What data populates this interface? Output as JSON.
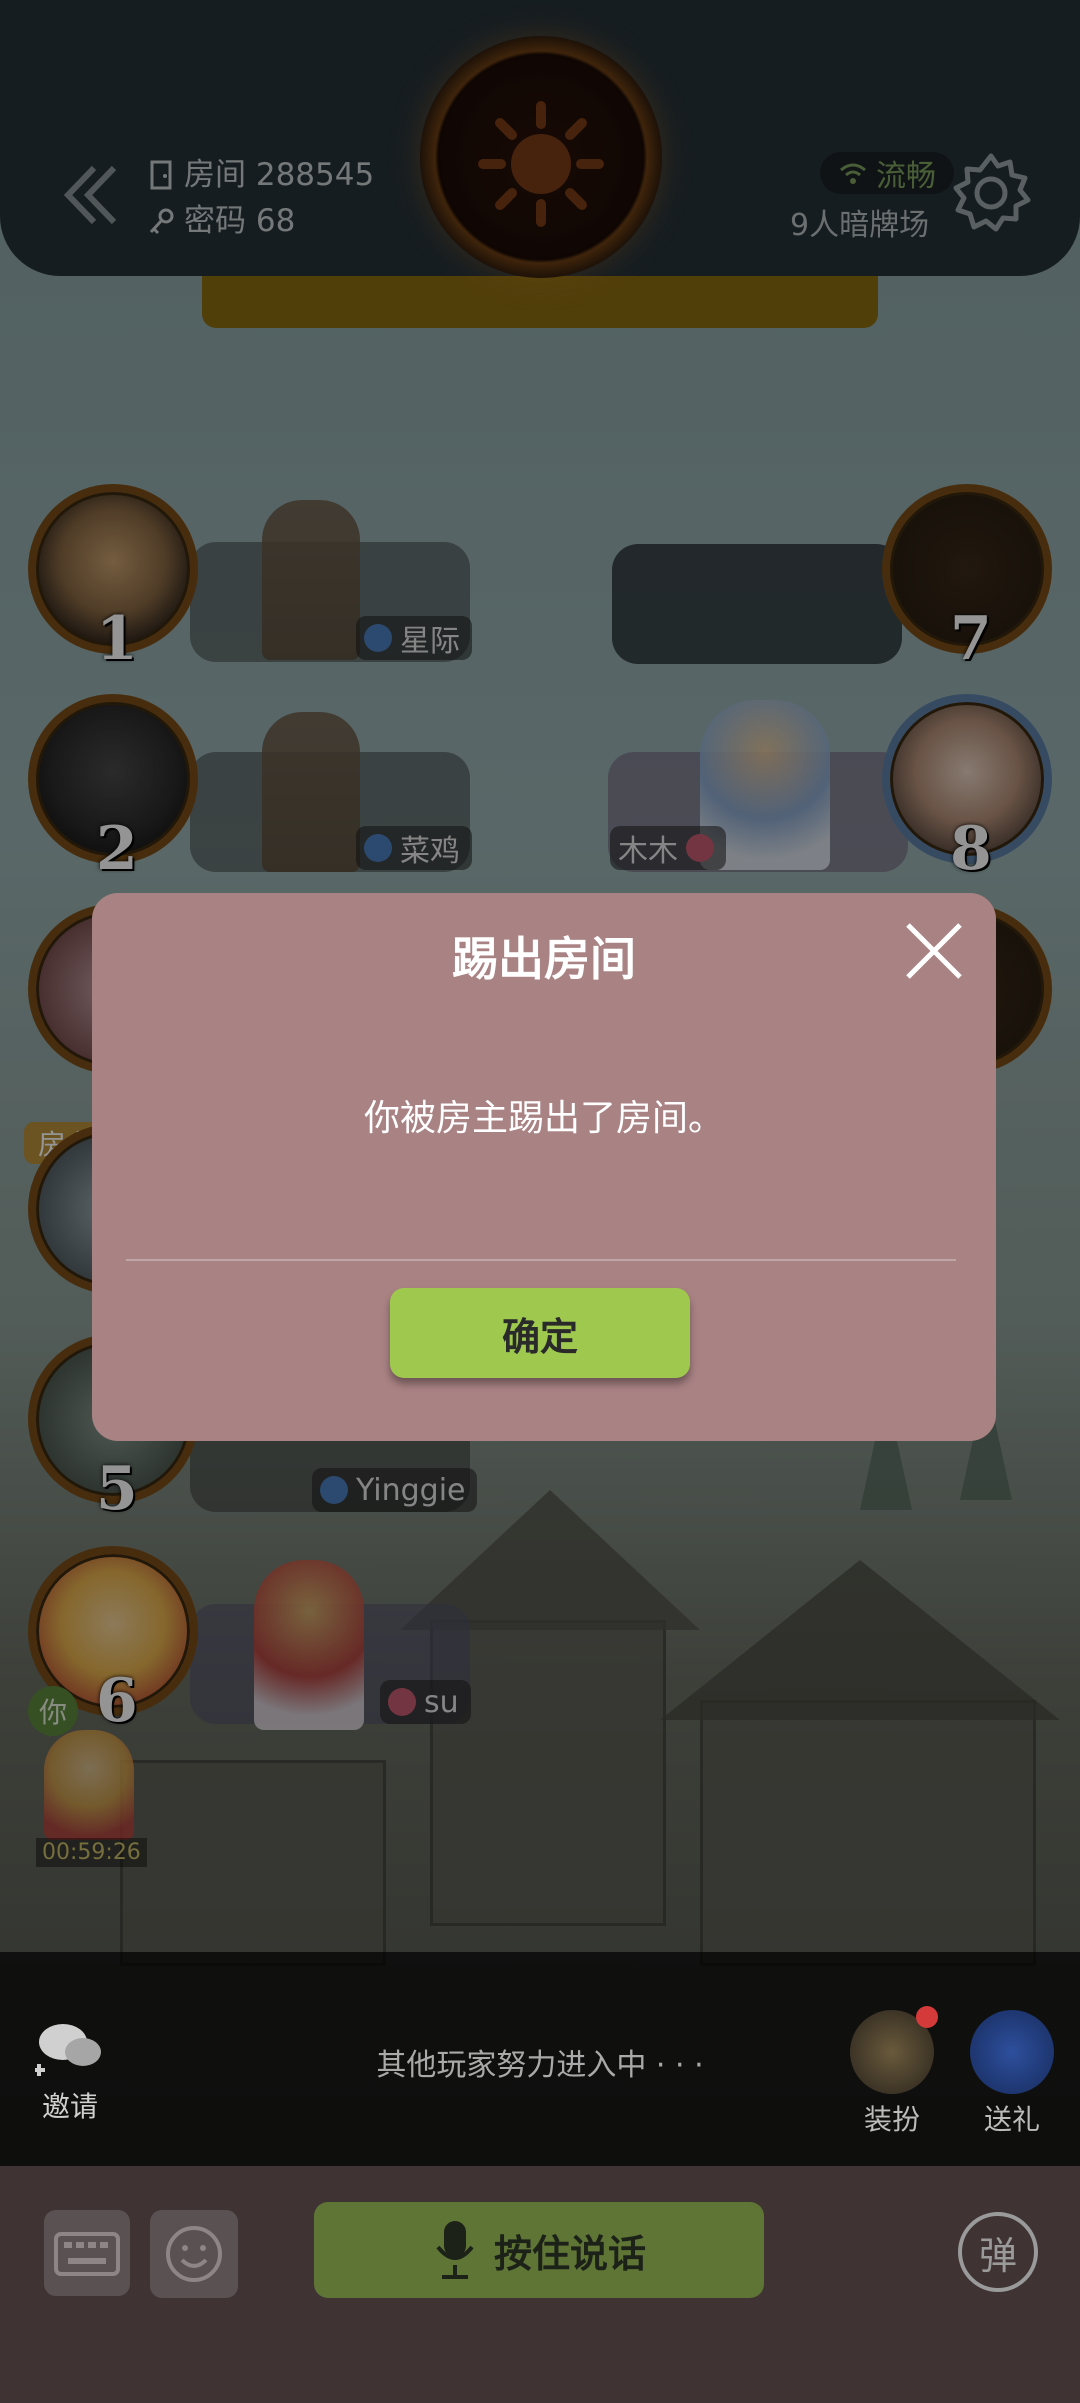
{
  "header": {
    "room_label": "房间 288545",
    "password_label": "密码 68",
    "network_status": "流畅",
    "game_mode": "9人暗牌场"
  },
  "seats": {
    "left": [
      {
        "number": "1",
        "name": "星际",
        "gender": "male"
      },
      {
        "number": "2",
        "name": "菜鸡",
        "gender": "male"
      },
      {
        "number": "5",
        "name": "Yinggie",
        "gender": "male"
      },
      {
        "number": "6",
        "name": "su",
        "gender": "female"
      }
    ],
    "right": [
      {
        "number": "7",
        "name": ""
      },
      {
        "number": "8",
        "name": "木木",
        "gender": "female"
      }
    ],
    "host_tag": "房主",
    "you_badge": "你",
    "timer": "00:59:26"
  },
  "bottom": {
    "invite_label": "邀请",
    "waiting_text": "其他玩家努力进入中 · · ·",
    "dress_label": "装扮",
    "gift_label": "送礼",
    "talk_label": "按住说话",
    "danmu_label": "弹"
  },
  "dialog": {
    "title": "踢出房间",
    "message": "你被房主踢出了房间。",
    "confirm_label": "确定"
  },
  "colors": {
    "dialog_bg": "#a98284",
    "confirm_bg": "#9ec94e",
    "talk_bg": "#5f7536",
    "topbar_bg": "#263238"
  }
}
